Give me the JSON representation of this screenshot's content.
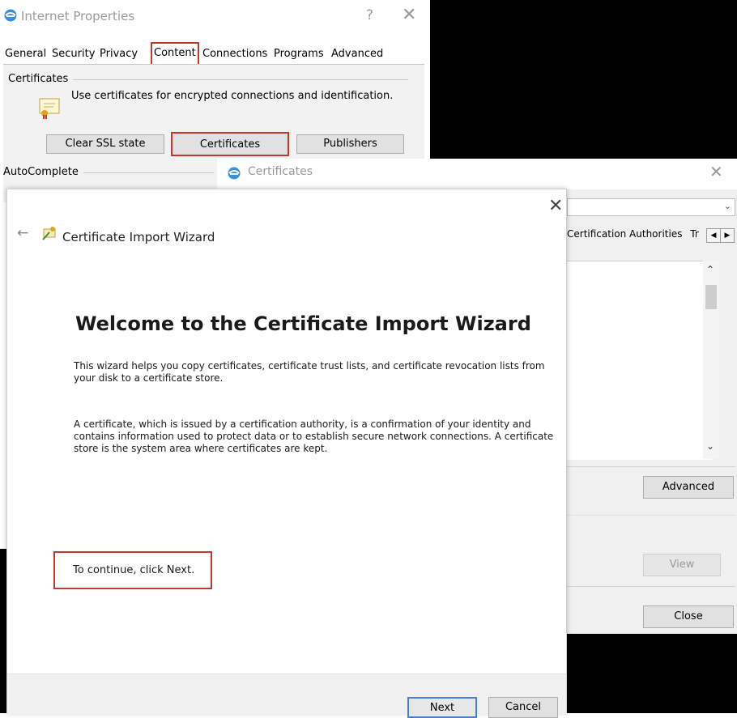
{
  "internet_properties": {
    "title": "Internet Properties",
    "help": "?",
    "close": "✕",
    "tabs": [
      "General",
      "Security",
      "Privacy",
      "Content",
      "Connections",
      "Programs",
      "Advanced"
    ],
    "selected_tab": "Content",
    "certificates_group": "Certificates",
    "certificates_desc": "Use certificates for encrypted connections and identification.",
    "buttons": {
      "clear_ssl": "Clear SSL state",
      "certificates": "Certificates",
      "publishers": "Publishers"
    },
    "autocomplete_group": "AutoComplete"
  },
  "certificates_window": {
    "title": "Certificates",
    "close": "✕",
    "tab_partial": "Certification Authorities",
    "tab_partial2": "Tr",
    "buttons": {
      "advanced": "Advanced",
      "view": "View",
      "close": "Close"
    }
  },
  "wizard": {
    "close": "✕",
    "back": "←",
    "title": "Certificate Import Wizard",
    "heading": "Welcome to the Certificate Import Wizard",
    "paragraph1": "This wizard helps you copy certificates, certificate trust lists, and certificate revocation lists from your disk to a certificate store.",
    "paragraph2": "A certificate, which is issued by a certification authority, is a confirmation of your identity and contains information used to protect data or to establish secure network connections. A certificate store is the system area where certificates are kept.",
    "continue_text": "To continue, click Next.",
    "buttons": {
      "next": "Next",
      "cancel": "Cancel"
    }
  },
  "colors": {
    "highlight_red": "#c0392b",
    "dialog_bg": "#f0f0f0",
    "button_bg": "#e1e1e1"
  }
}
